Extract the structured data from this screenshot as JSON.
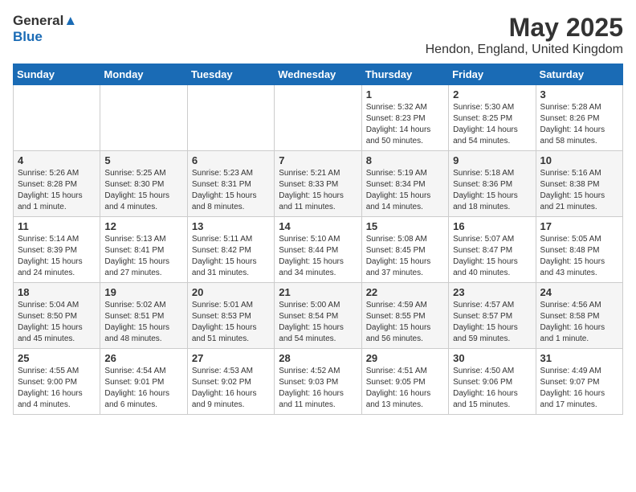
{
  "header": {
    "logo_general": "General",
    "logo_blue": "Blue",
    "month_title": "May 2025",
    "location": "Hendon, England, United Kingdom"
  },
  "weekdays": [
    "Sunday",
    "Monday",
    "Tuesday",
    "Wednesday",
    "Thursday",
    "Friday",
    "Saturday"
  ],
  "weeks": [
    [
      {
        "day": "",
        "info": ""
      },
      {
        "day": "",
        "info": ""
      },
      {
        "day": "",
        "info": ""
      },
      {
        "day": "",
        "info": ""
      },
      {
        "day": "1",
        "info": "Sunrise: 5:32 AM\nSunset: 8:23 PM\nDaylight: 14 hours\nand 50 minutes."
      },
      {
        "day": "2",
        "info": "Sunrise: 5:30 AM\nSunset: 8:25 PM\nDaylight: 14 hours\nand 54 minutes."
      },
      {
        "day": "3",
        "info": "Sunrise: 5:28 AM\nSunset: 8:26 PM\nDaylight: 14 hours\nand 58 minutes."
      }
    ],
    [
      {
        "day": "4",
        "info": "Sunrise: 5:26 AM\nSunset: 8:28 PM\nDaylight: 15 hours\nand 1 minute."
      },
      {
        "day": "5",
        "info": "Sunrise: 5:25 AM\nSunset: 8:30 PM\nDaylight: 15 hours\nand 4 minutes."
      },
      {
        "day": "6",
        "info": "Sunrise: 5:23 AM\nSunset: 8:31 PM\nDaylight: 15 hours\nand 8 minutes."
      },
      {
        "day": "7",
        "info": "Sunrise: 5:21 AM\nSunset: 8:33 PM\nDaylight: 15 hours\nand 11 minutes."
      },
      {
        "day": "8",
        "info": "Sunrise: 5:19 AM\nSunset: 8:34 PM\nDaylight: 15 hours\nand 14 minutes."
      },
      {
        "day": "9",
        "info": "Sunrise: 5:18 AM\nSunset: 8:36 PM\nDaylight: 15 hours\nand 18 minutes."
      },
      {
        "day": "10",
        "info": "Sunrise: 5:16 AM\nSunset: 8:38 PM\nDaylight: 15 hours\nand 21 minutes."
      }
    ],
    [
      {
        "day": "11",
        "info": "Sunrise: 5:14 AM\nSunset: 8:39 PM\nDaylight: 15 hours\nand 24 minutes."
      },
      {
        "day": "12",
        "info": "Sunrise: 5:13 AM\nSunset: 8:41 PM\nDaylight: 15 hours\nand 27 minutes."
      },
      {
        "day": "13",
        "info": "Sunrise: 5:11 AM\nSunset: 8:42 PM\nDaylight: 15 hours\nand 31 minutes."
      },
      {
        "day": "14",
        "info": "Sunrise: 5:10 AM\nSunset: 8:44 PM\nDaylight: 15 hours\nand 34 minutes."
      },
      {
        "day": "15",
        "info": "Sunrise: 5:08 AM\nSunset: 8:45 PM\nDaylight: 15 hours\nand 37 minutes."
      },
      {
        "day": "16",
        "info": "Sunrise: 5:07 AM\nSunset: 8:47 PM\nDaylight: 15 hours\nand 40 minutes."
      },
      {
        "day": "17",
        "info": "Sunrise: 5:05 AM\nSunset: 8:48 PM\nDaylight: 15 hours\nand 43 minutes."
      }
    ],
    [
      {
        "day": "18",
        "info": "Sunrise: 5:04 AM\nSunset: 8:50 PM\nDaylight: 15 hours\nand 45 minutes."
      },
      {
        "day": "19",
        "info": "Sunrise: 5:02 AM\nSunset: 8:51 PM\nDaylight: 15 hours\nand 48 minutes."
      },
      {
        "day": "20",
        "info": "Sunrise: 5:01 AM\nSunset: 8:53 PM\nDaylight: 15 hours\nand 51 minutes."
      },
      {
        "day": "21",
        "info": "Sunrise: 5:00 AM\nSunset: 8:54 PM\nDaylight: 15 hours\nand 54 minutes."
      },
      {
        "day": "22",
        "info": "Sunrise: 4:59 AM\nSunset: 8:55 PM\nDaylight: 15 hours\nand 56 minutes."
      },
      {
        "day": "23",
        "info": "Sunrise: 4:57 AM\nSunset: 8:57 PM\nDaylight: 15 hours\nand 59 minutes."
      },
      {
        "day": "24",
        "info": "Sunrise: 4:56 AM\nSunset: 8:58 PM\nDaylight: 16 hours\nand 1 minute."
      }
    ],
    [
      {
        "day": "25",
        "info": "Sunrise: 4:55 AM\nSunset: 9:00 PM\nDaylight: 16 hours\nand 4 minutes."
      },
      {
        "day": "26",
        "info": "Sunrise: 4:54 AM\nSunset: 9:01 PM\nDaylight: 16 hours\nand 6 minutes."
      },
      {
        "day": "27",
        "info": "Sunrise: 4:53 AM\nSunset: 9:02 PM\nDaylight: 16 hours\nand 9 minutes."
      },
      {
        "day": "28",
        "info": "Sunrise: 4:52 AM\nSunset: 9:03 PM\nDaylight: 16 hours\nand 11 minutes."
      },
      {
        "day": "29",
        "info": "Sunrise: 4:51 AM\nSunset: 9:05 PM\nDaylight: 16 hours\nand 13 minutes."
      },
      {
        "day": "30",
        "info": "Sunrise: 4:50 AM\nSunset: 9:06 PM\nDaylight: 16 hours\nand 15 minutes."
      },
      {
        "day": "31",
        "info": "Sunrise: 4:49 AM\nSunset: 9:07 PM\nDaylight: 16 hours\nand 17 minutes."
      }
    ]
  ]
}
